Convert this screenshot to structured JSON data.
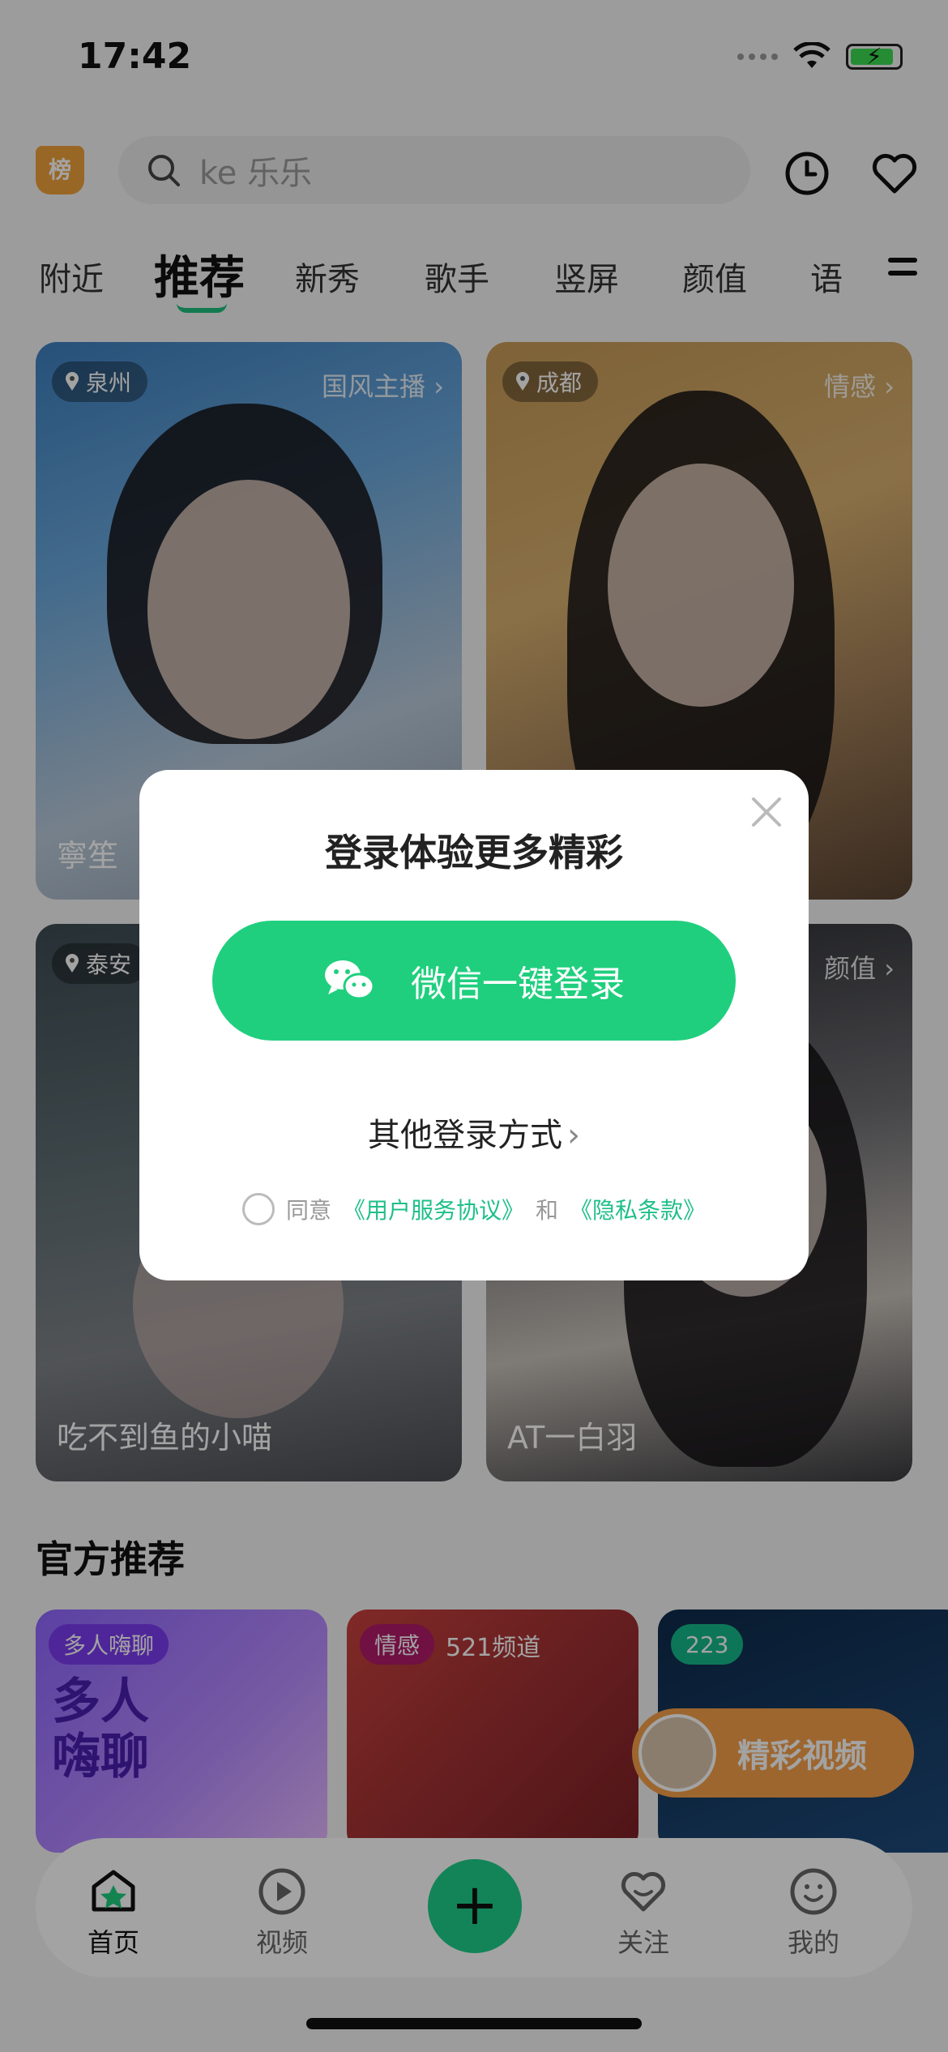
{
  "status": {
    "time": "17:42"
  },
  "header": {
    "rank_label": "榜",
    "search_placeholder": "ke 乐乐"
  },
  "tabs": [
    {
      "label": "附近"
    },
    {
      "label": "推荐"
    },
    {
      "label": "新秀"
    },
    {
      "label": "歌手"
    },
    {
      "label": "竖屏"
    },
    {
      "label": "颜值"
    },
    {
      "label": "语"
    }
  ],
  "cards": [
    {
      "location": "泉州",
      "category": "国风主播 ›",
      "name": "寧笙"
    },
    {
      "location": "成都",
      "category": "情感 ›",
      "name": ""
    },
    {
      "location": "泰安",
      "category": "",
      "name": "吃不到鱼的小喵"
    },
    {
      "location": "",
      "category": "颜值 ›",
      "name": "AT一白羽"
    }
  ],
  "section": {
    "title": "官方推荐"
  },
  "recommend": [
    {
      "tag": "多人嗨聊",
      "big_text": "多人\n嗨聊",
      "subtitle": ""
    },
    {
      "tag": "情感",
      "big_text": "",
      "subtitle": "521频道"
    },
    {
      "tag": "223",
      "big_text": "",
      "subtitle": ""
    }
  ],
  "float_video": {
    "label": "精彩视频"
  },
  "tabbar": [
    {
      "label": "首页",
      "icon": "home-icon"
    },
    {
      "label": "视频",
      "icon": "play-icon"
    },
    {
      "label": "+",
      "icon": "plus-icon"
    },
    {
      "label": "关注",
      "icon": "heart-icon"
    },
    {
      "label": "我的",
      "icon": "smile-icon"
    }
  ],
  "modal": {
    "title": "登录体验更多精彩",
    "wechat_button": "微信一键登录",
    "other_login": "其他登录方式",
    "agree_prefix": "同意",
    "user_agreement": "《用户服务协议》",
    "and": "和",
    "privacy": "《隐私条款》"
  },
  "colors": {
    "accent_green": "#1fcf7e",
    "badge_orange": "#f0a23a"
  }
}
